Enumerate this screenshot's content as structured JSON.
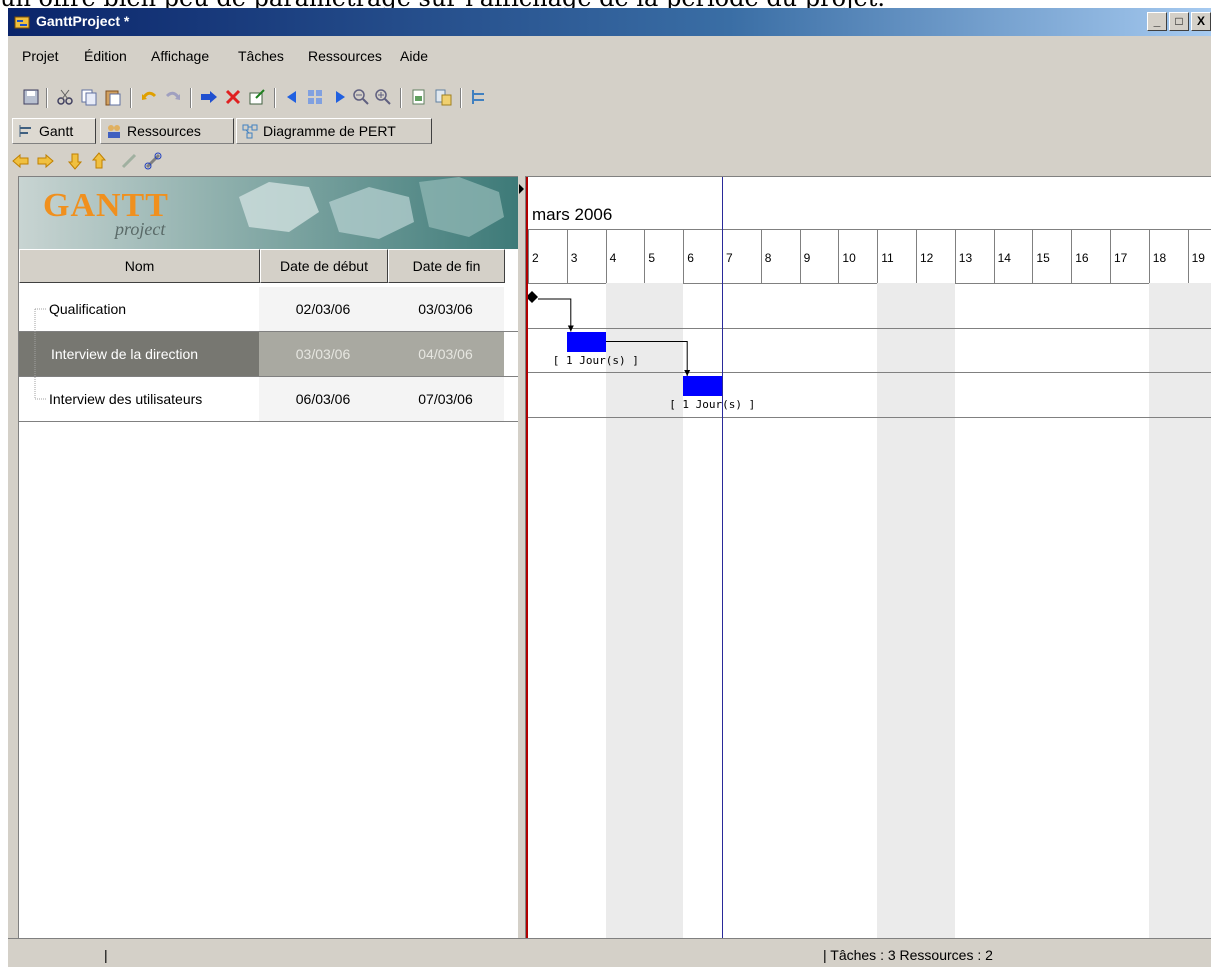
{
  "caption": "un offre bien peu de paramétrage sur l'affichage de la période du projet.",
  "window": {
    "title": "GanttProject *",
    "min": "_",
    "max": "□",
    "close": "X"
  },
  "menu": [
    "Projet",
    "Édition",
    "Affichage",
    "Tâches",
    "Ressources",
    "Aide"
  ],
  "toolbar_icons": [
    "save-icon",
    "cut-icon",
    "copy-icon",
    "paste-icon",
    "undo-icon",
    "redo-icon",
    "insert-task-icon",
    "delete-icon",
    "properties-icon",
    "back-icon",
    "grid-icon",
    "forward-icon",
    "zoom-out-icon",
    "zoom-in-icon",
    "print-icon",
    "export-icon",
    "critical-path-icon"
  ],
  "tabs": [
    {
      "label": "Gantt",
      "icon": "gantt-icon"
    },
    {
      "label": "Ressources",
      "icon": "resources-icon"
    },
    {
      "label": "Diagramme de PERT",
      "icon": "pert-icon"
    }
  ],
  "subtoolbar_icons": [
    "arrow-left-icon",
    "arrow-right-icon",
    "arrow-down-icon",
    "arrow-up-icon",
    "unlink-icon",
    "link-icon"
  ],
  "logo": {
    "text": "GANTT",
    "sub": "project"
  },
  "table": {
    "headers": [
      "Nom",
      "Date de début",
      "Date de fin"
    ],
    "rows": [
      {
        "name": "Qualification",
        "start": "02/03/06",
        "end": "03/03/06",
        "selected": false
      },
      {
        "name": "Interview de la direction",
        "start": "03/03/06",
        "end": "04/03/06",
        "selected": true
      },
      {
        "name": "Interview des utilisateurs",
        "start": "06/03/06",
        "end": "07/03/06",
        "selected": false
      }
    ]
  },
  "gantt": {
    "month": "mars 2006",
    "days": [
      "2",
      "3",
      "4",
      "5",
      "6",
      "7",
      "8",
      "9",
      "10",
      "11",
      "12",
      "13",
      "14",
      "15",
      "16",
      "17",
      "18",
      "19"
    ],
    "weekend_days": [
      "4",
      "5",
      "11",
      "12",
      "18",
      "19"
    ],
    "today": "7",
    "milestone_day": "2",
    "bars": [
      {
        "task": "Interview de la direction",
        "start_day": "3",
        "end_day": "4",
        "label": "[ 1 Jour(s) ]"
      },
      {
        "task": "Interview des utilisateurs",
        "start_day": "6",
        "end_day": "7",
        "label": "[ 1 Jour(s) ]"
      }
    ],
    "bar_color": "#0000ff"
  },
  "status": {
    "left": "|",
    "right": "| Tâches : 3  Ressources : 2"
  }
}
